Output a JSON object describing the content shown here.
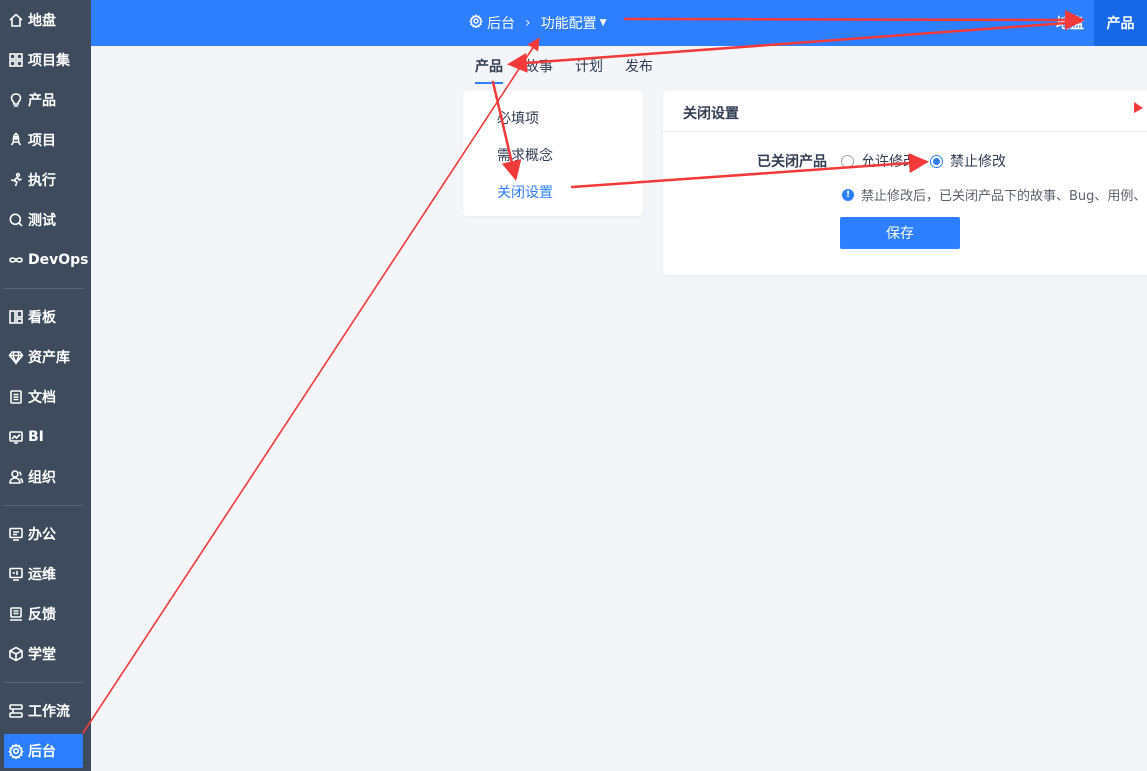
{
  "sidebar": {
    "items": [
      {
        "label": "地盘",
        "icon": "home-icon"
      },
      {
        "label": "项目集",
        "icon": "grid-icon"
      },
      {
        "label": "产品",
        "icon": "lightbulb-icon"
      },
      {
        "label": "项目",
        "icon": "rocket-icon"
      },
      {
        "label": "执行",
        "icon": "run-icon"
      },
      {
        "label": "测试",
        "icon": "search-icon"
      },
      {
        "label": "DevOps",
        "icon": "infinity-icon"
      },
      {
        "label": "看板",
        "icon": "kanban-icon"
      },
      {
        "label": "资产库",
        "icon": "diamond-icon"
      },
      {
        "label": "文档",
        "icon": "document-icon"
      },
      {
        "label": "BI",
        "icon": "monitor-icon"
      },
      {
        "label": "组织",
        "icon": "people-icon"
      },
      {
        "label": "办公",
        "icon": "oa-icon"
      },
      {
        "label": "运维",
        "icon": "ops-icon"
      },
      {
        "label": "反馈",
        "icon": "feedback-icon"
      },
      {
        "label": "学堂",
        "icon": "cube-icon"
      },
      {
        "label": "工作流",
        "icon": "workflow-icon"
      },
      {
        "label": "后台",
        "icon": "gear-icon"
      }
    ],
    "active_label": "后台"
  },
  "header": {
    "breadcrumb_root": "后台",
    "breadcrumb_current": "功能配置",
    "separator": "›",
    "right_map": "地盘",
    "right_product": "产品"
  },
  "tabs": [
    "产品",
    "故事",
    "计划",
    "发布"
  ],
  "menu": [
    "必填项",
    "需求概念",
    "关闭设置"
  ],
  "panel": {
    "title": "关闭设置",
    "field_label": "已关闭产品",
    "options": [
      {
        "label": "允许修改",
        "checked": false
      },
      {
        "label": "禁止修改",
        "checked": true
      }
    ],
    "hint": "禁止修改后，已关闭产品下的故事、Bug、用例、",
    "save_label": "保存"
  },
  "colors": {
    "primary": "#2e7fff",
    "sidebar_bg": "#3d4b5c",
    "page_bg": "#f3f5f8",
    "annotation": "#f23a3a"
  }
}
